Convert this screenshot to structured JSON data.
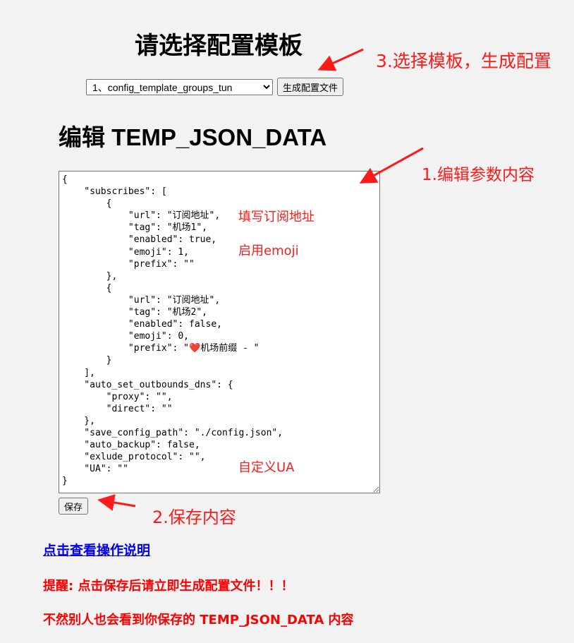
{
  "header": {
    "title": "请选择配置模板"
  },
  "template_select": {
    "selected": "1、config_template_groups_tun",
    "options": [
      "1、config_template_groups_tun"
    ]
  },
  "generate_button": {
    "label": "生成配置文件"
  },
  "editor": {
    "heading": "编辑 TEMP_JSON_DATA",
    "content": "{\n    \"subscribes\": [\n        {\n            \"url\": \"订阅地址\",\n            \"tag\": \"机场1\",\n            \"enabled\": true,\n            \"emoji\": 1,\n            \"prefix\": \"\"\n        },\n        {\n            \"url\": \"订阅地址\",\n            \"tag\": \"机场2\",\n            \"enabled\": false,\n            \"emoji\": 0,\n            \"prefix\": \"❤️机场前缀 - \"\n        }\n    ],\n    \"auto_set_outbounds_dns\": {\n        \"proxy\": \"\",\n        \"direct\": \"\"\n    },\n    \"save_config_path\": \"./config.json\",\n    \"auto_backup\": false,\n    \"exlude_protocol\": \"\",\n    \"UA\": \"\"\n}"
  },
  "save_button": {
    "label": "保存"
  },
  "help_link": {
    "label": "点击查看操作说明"
  },
  "warnings": [
    "提醒: 点击保存后请立即生成配置文件！！！",
    "不然别人也会看到你保存的 TEMP_JSON_DATA 内容"
  ],
  "annotations": {
    "step3": "3.选择模板，生成配置",
    "step1": "1.编辑参数内容",
    "step2": "2.保存内容",
    "fill_url": "填写订阅地址",
    "enable_emoji": "启用emoji",
    "custom_ua": "自定义UA"
  },
  "colors": {
    "background": "#f2f2f2",
    "annotation": "#ff1a1a",
    "link": "#0000ee",
    "warning": "#ff0000"
  }
}
